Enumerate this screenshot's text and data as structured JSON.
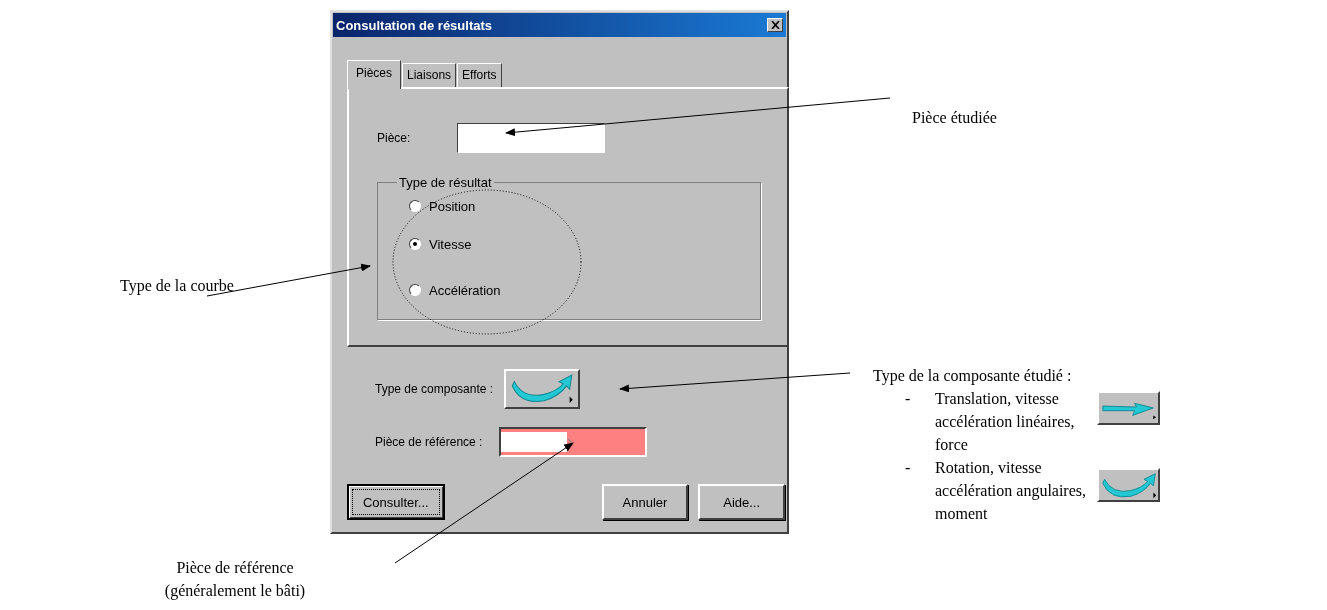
{
  "window": {
    "title": "Consultation de résultats"
  },
  "tabs": [
    {
      "label": "Pièces",
      "selected": true
    },
    {
      "label": "Liaisons",
      "selected": false
    },
    {
      "label": "Efforts",
      "selected": false
    }
  ],
  "piece_field": {
    "label": "Pièce:"
  },
  "result_type": {
    "legend": "Type de résultat",
    "options": [
      {
        "label": "Position",
        "selected": false
      },
      {
        "label": "Vitesse",
        "selected": true
      },
      {
        "label": "Accélération",
        "selected": false
      }
    ]
  },
  "component_type": {
    "label": "Type de composante :"
  },
  "reference_field": {
    "label": "Pièce de référence :"
  },
  "buttons": [
    {
      "label": "Consulter...",
      "focused": true
    },
    {
      "label": "Annuler",
      "focused": false
    },
    {
      "label": "Aide...",
      "focused": false
    }
  ],
  "annotations": [
    {
      "kind": "text",
      "text": "Pièce étudiée"
    },
    {
      "kind": "text",
      "text": "Type de la courbe"
    },
    {
      "kind": "list",
      "title": "Type de la composante étudié :",
      "items": [
        {
          "marker": "-",
          "text": "Translation, vitesse accélération linéaires, force",
          "kind": "translation"
        },
        {
          "marker": "-",
          "text": "Rotation, vitesse accélération angulaires, moment",
          "kind": "rotation"
        }
      ]
    },
    {
      "kind": "text",
      "text": "Pièce de référence (généralement le bâti)"
    }
  ]
}
